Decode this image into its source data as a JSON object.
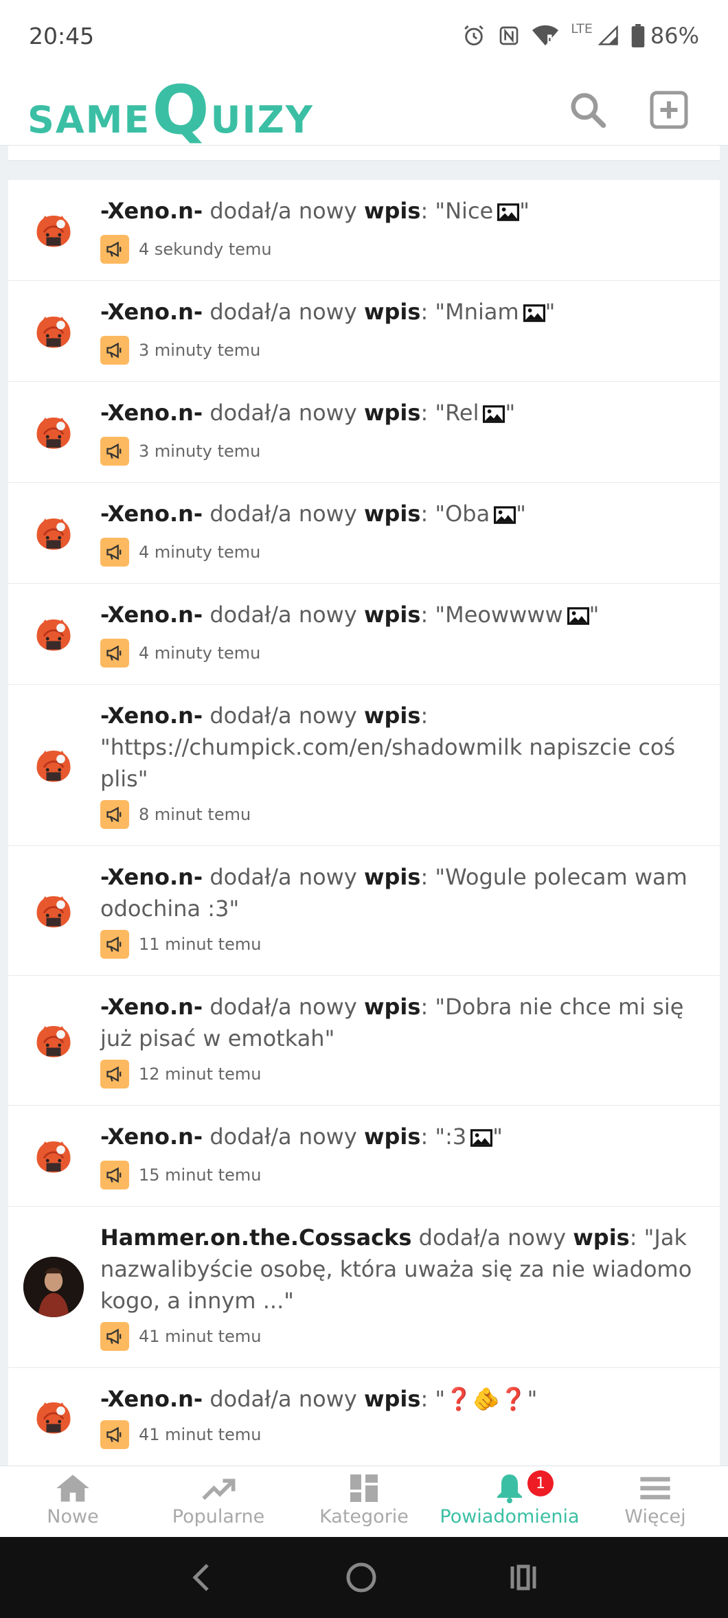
{
  "status_bar": {
    "time": "20:45",
    "lte": "LTE",
    "battery": "86%"
  },
  "logo": {
    "same": "SAME",
    "q": "Q",
    "uizy": "UIZY"
  },
  "feed": [
    {
      "user": "-Xeno.n-",
      "action": "dodał/a nowy",
      "type": "wpis",
      "text_open": ": \"Nice",
      "has_image": true,
      "text_close": "\"",
      "time": "4 sekundy temu"
    },
    {
      "user": "-Xeno.n-",
      "action": "dodał/a nowy",
      "type": "wpis",
      "text_open": ": \"Mniam",
      "has_image": true,
      "text_close": "\"",
      "time": "3 minuty temu"
    },
    {
      "user": "-Xeno.n-",
      "action": "dodał/a nowy",
      "type": "wpis",
      "text_open": ": \"Rel",
      "has_image": true,
      "text_close": "\"",
      "time": "3 minuty temu"
    },
    {
      "user": "-Xeno.n-",
      "action": "dodał/a nowy",
      "type": "wpis",
      "text_open": ": \"Oba",
      "has_image": true,
      "text_close": "\"",
      "time": "4 minuty temu"
    },
    {
      "user": "-Xeno.n-",
      "action": "dodał/a nowy",
      "type": "wpis",
      "text_open": ": \"Meowwww",
      "has_image": true,
      "text_close": "\"",
      "time": "4 minuty temu"
    },
    {
      "user": "-Xeno.n-",
      "action": "dodał/a nowy",
      "type": "wpis",
      "text_open": ": \"https://chumpick.com/en/shadowmilk napiszcie coś plis\"",
      "has_image": false,
      "text_close": "",
      "time": "8 minut temu"
    },
    {
      "user": "-Xeno.n-",
      "action": "dodał/a nowy",
      "type": "wpis",
      "text_open": ": \"Wogule polecam wam odochina :3\"",
      "has_image": false,
      "text_close": "",
      "time": "11 minut temu"
    },
    {
      "user": "-Xeno.n-",
      "action": "dodał/a nowy",
      "type": "wpis",
      "text_open": ": \"Dobra nie chce mi się już pisać w emotkah\"",
      "has_image": false,
      "text_close": "",
      "time": "12 minut temu"
    },
    {
      "user": "-Xeno.n-",
      "action": "dodał/a nowy",
      "type": "wpis",
      "text_open": ": \":3",
      "has_image": true,
      "text_close": "\"",
      "time": "15 minut temu"
    },
    {
      "user": "Hammer.on.the.Cossacks",
      "action": "dodał/a nowy",
      "type": "wpis",
      "text_open": ": \"Jak nazwalibyście osobę, która uważa się za nie wiadomo kogo, a innym ...\"",
      "has_image": false,
      "text_close": "",
      "time": "41 minut temu",
      "avatar": "hammer"
    },
    {
      "user": "-Xeno.n-",
      "action": "dodał/a nowy",
      "type": "wpis",
      "text_open": ": \"❓🫵❓\"",
      "has_image": false,
      "text_close": "",
      "time": "41 minut temu"
    }
  ],
  "bottom_nav": [
    {
      "label": "Nowe",
      "icon": "home-icon"
    },
    {
      "label": "Popularne",
      "icon": "trending-icon"
    },
    {
      "label": "Kategorie",
      "icon": "dashboard-icon"
    },
    {
      "label": "Powiadomienia",
      "icon": "bell-icon",
      "active": true,
      "badge": "1"
    },
    {
      "label": "Więcej",
      "icon": "menu-icon"
    }
  ],
  "colors": {
    "brand": "#3bbfa4",
    "badge": "#fdb95f",
    "notification": "#ee1c25"
  }
}
